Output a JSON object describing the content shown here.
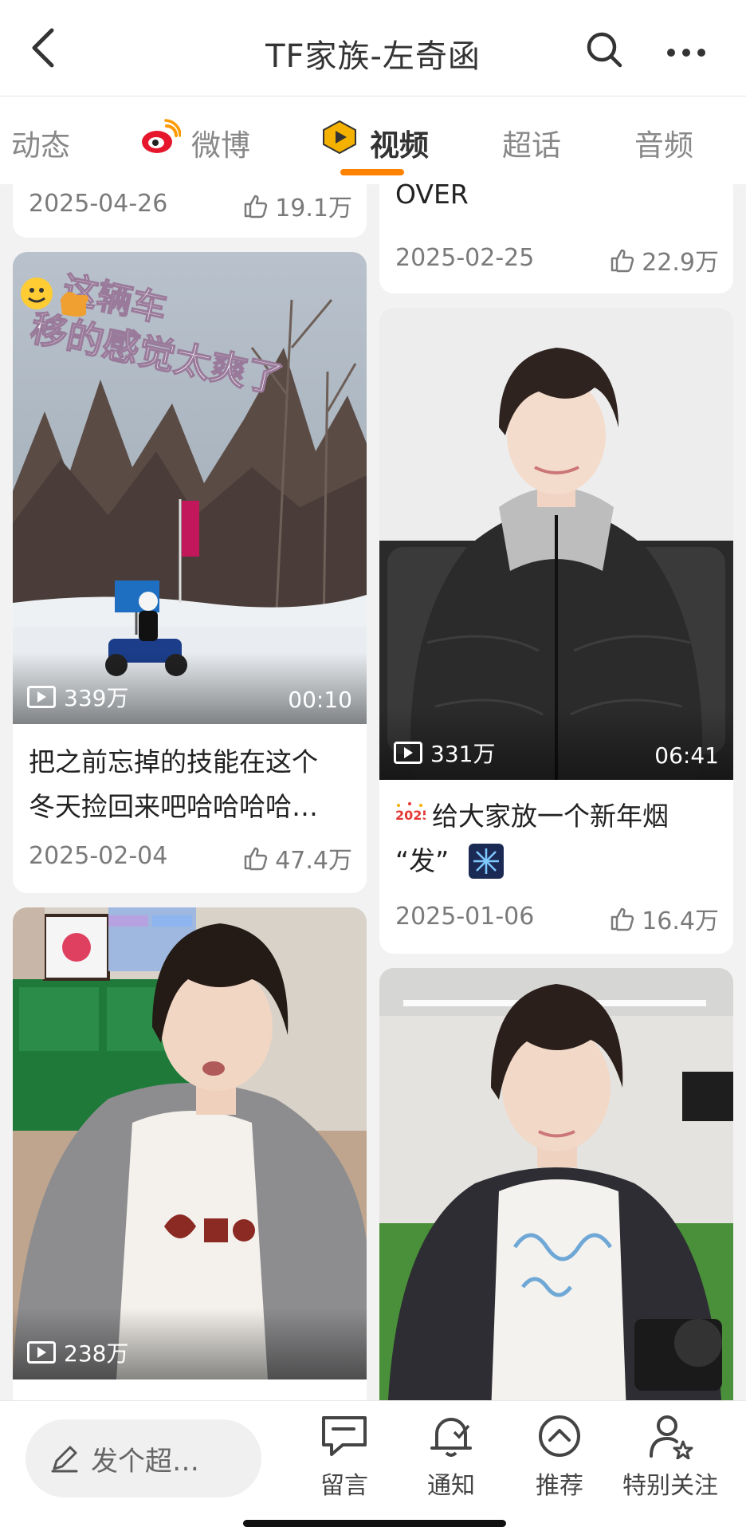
{
  "header": {
    "title": "TF家族-左奇函"
  },
  "tabs": [
    {
      "label": "动态"
    },
    {
      "label": "微博"
    },
    {
      "label": "视频"
    },
    {
      "label": "超话"
    },
    {
      "label": "音频"
    }
  ],
  "colors": {
    "accent": "#ff8200",
    "weibo_red": "#e6162d"
  },
  "cards": {
    "c1": {
      "date": "2025-04-26",
      "likes": "19.1万"
    },
    "c2": {
      "title": "OVER",
      "date": "2025-02-25",
      "likes": "22.9万"
    },
    "c3": {
      "overlay_text": "移的感觉太爽了",
      "overlay_text2": "这辆车",
      "views": "339万",
      "duration": "00:10",
      "title_line1": "把之前忘掉的技能在这个",
      "title_line2": "冬天捡回来吧哈哈哈哈…",
      "date": "2025-02-04",
      "likes": "47.4万"
    },
    "c4": {
      "views": "331万",
      "duration": "06:41",
      "badge": "2025",
      "title_line1": "给大家放一个新年烟",
      "title_line2": "“发”",
      "date": "2025-01-06",
      "likes": "16.4万"
    },
    "c5": {
      "views": "238万"
    },
    "c6": {}
  },
  "bottom_bar": {
    "post_placeholder": "发个超…",
    "items": [
      {
        "label": "留言",
        "icon": "message-icon"
      },
      {
        "label": "通知",
        "icon": "bell-icon"
      },
      {
        "label": "推荐",
        "icon": "up-circle-icon"
      },
      {
        "label": "特别关注",
        "icon": "user-star-icon"
      }
    ]
  }
}
